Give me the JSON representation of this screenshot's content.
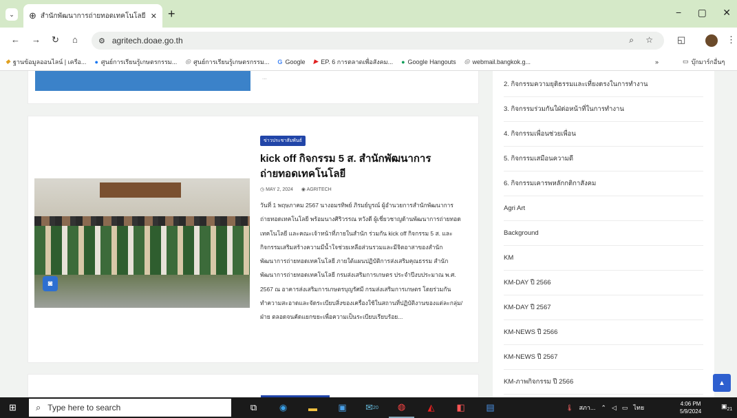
{
  "browser": {
    "tab_title": "สำนักพัฒนาการถ่ายทอดเทคโนโลยี",
    "new_tab": "+",
    "url": "agritech.doae.go.th",
    "window_controls": [
      "−",
      "▢",
      "✕"
    ]
  },
  "bookmarks": [
    {
      "icon": "folder-icon",
      "label": "ฐานข้อมูลออนไลน์ | เครือ..."
    },
    {
      "icon": "facebook-icon",
      "label": "ศูนย์การเรียนรู้เกษตรกรรม..."
    },
    {
      "icon": "globe-icon",
      "label": "ศูนย์การเรียนรู้เกษตรกรรม..."
    },
    {
      "icon": "google-icon",
      "label": "Google"
    },
    {
      "icon": "youtube-icon",
      "label": "EP. 6 การตลาดเพื่อสังคม..."
    },
    {
      "icon": "hangouts-icon",
      "label": "Google Hangouts"
    },
    {
      "icon": "globe-icon",
      "label": "webmail.bangkok.g..."
    }
  ],
  "bookmarks_more": "»",
  "bookmarks_folder": "บุ๊กมาร์กอื่นๆ",
  "top_card_excerpt_tail": "...",
  "post": {
    "category": "ข่าวประชาสัมพันธ์",
    "title": "kick off กิจกรรม 5 ส. สำนักพัฒนาการถ่ายทอดเทคโนโลยี",
    "date": "MAY 2, 2024",
    "author": "AGRITECH",
    "excerpt": "วันที่ 1 พฤษภาคม 2567 นางอมรทิพย์ ภิรมย์บูรณ์ ผู้อำนวยการสำนักพัฒนาการถ่ายทอดเทคโนโลยี พร้อมนางศิริวรรณ หวังดี ผู้เชี่ยวชาญด้านพัฒนาการถ่ายทอดเทคโนโลยี และคณะเจ้าหน้าที่ภายในสำนัก ร่วมกัน kick off กิจกรรม 5 ส. และ กิจกรรมเสริมสร้างความมีน้ำใจช่วยเหลือส่วนรวมและมีจิตอาสาของสำนักพัฒนาการถ่ายทอดเทคโนโลยี ภายใต้แผนปฏิบัติการส่งเสริมคุณธรรม สำนักพัฒนาการถ่ายทอดเทคโนโลยี กรมส่งเสริมการเกษตร ประจำปีงบประมาณ พ.ศ. 2567 ณ อาคารส่งเสริมการเกษตรบุญรัศมี กรมส่งเสริมการเกษตร โดยร่วมกันทำความสะอาดและจัดระเบียบสิ่งของเครื่องใช้ในสถานที่ปฏิบัติงานของแต่ละกลุ่ม/ฝ่าย ตลอดจนคัดแยกขยะเพื่อความเป็นระเบียบเรียบร้อย..."
  },
  "sidebar_items": [
    "2. กิจกรรมความยุติธรรมและเที่ยงตรงในการทำงาน",
    "3. กิจกรรมร่วมกันใฝ่ต่อหน้าที่ในการทำงาน",
    "4. กิจกรรมเพื่อนช่วยเพื่อน",
    "5. กิจกรรมเสมือนความดี",
    "6. กิจกรรมเคารพหลักกติกาสังคม",
    "Agri Art",
    "Background",
    "KM",
    "KM-DAY ปี 2566",
    "KM-DAY ปี 2567",
    "KM-NEWS ปี 2566",
    "KM-NEWS ปี 2567",
    "KM-ภาพกิจกรรม ปี 2566"
  ],
  "taskbar": {
    "search_placeholder": "Type here to search",
    "weather": "สภา...",
    "lang": "ไทย",
    "time": "4:06 PM",
    "date": "5/9/2024",
    "notif": "21",
    "badge_a": "20"
  }
}
